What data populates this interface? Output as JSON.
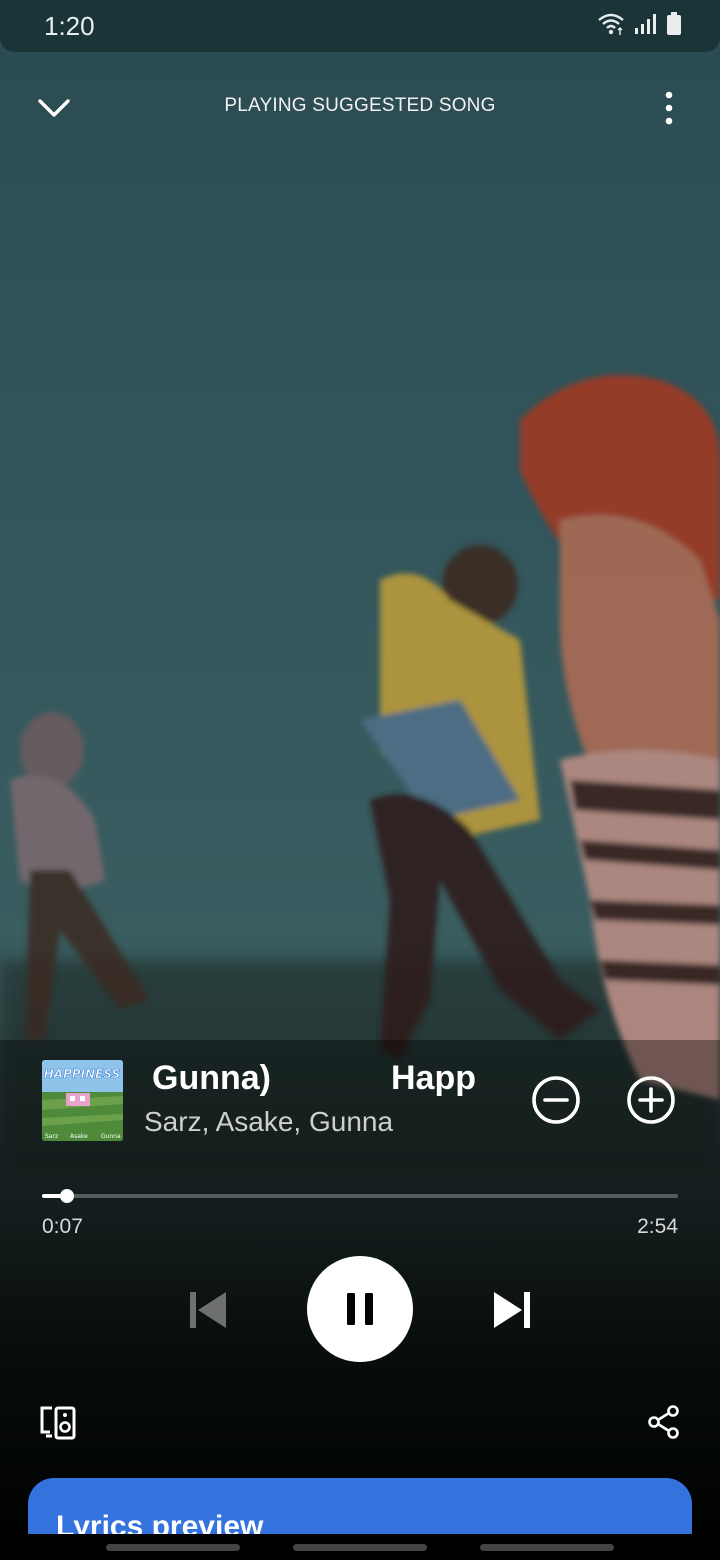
{
  "status_bar": {
    "time": "1:20",
    "icons": [
      "wifi-icon",
      "signal-icon",
      "battery-icon"
    ]
  },
  "header": {
    "context_label": "PLAYING SUGGESTED SONG",
    "collapse_icon": "chevron-down-icon",
    "more_icon": "more-vertical-icon"
  },
  "track": {
    "title_visible": "Gunna)",
    "title_visible_2": "Happ",
    "artists": "Sarz, Asake, Gunna",
    "album_art": {
      "title": "HAPPINESS",
      "credits": [
        "Sarz",
        "Asake",
        "Gunna"
      ]
    }
  },
  "progress": {
    "elapsed": "0:07",
    "total": "2:54",
    "fraction": 0.04
  },
  "controls": {
    "previous_icon": "skip-previous-icon",
    "pause_icon": "pause-icon",
    "next_icon": "skip-next-icon",
    "remove_icon": "minus-circle-icon",
    "add_icon": "plus-circle-icon"
  },
  "bottom_actions": {
    "devices_icon": "devices-icon",
    "share_icon": "share-icon"
  },
  "lyrics_card": {
    "title": "Lyrics preview"
  },
  "colors": {
    "accent": "#3472de",
    "status_bar": "#1b3438"
  }
}
